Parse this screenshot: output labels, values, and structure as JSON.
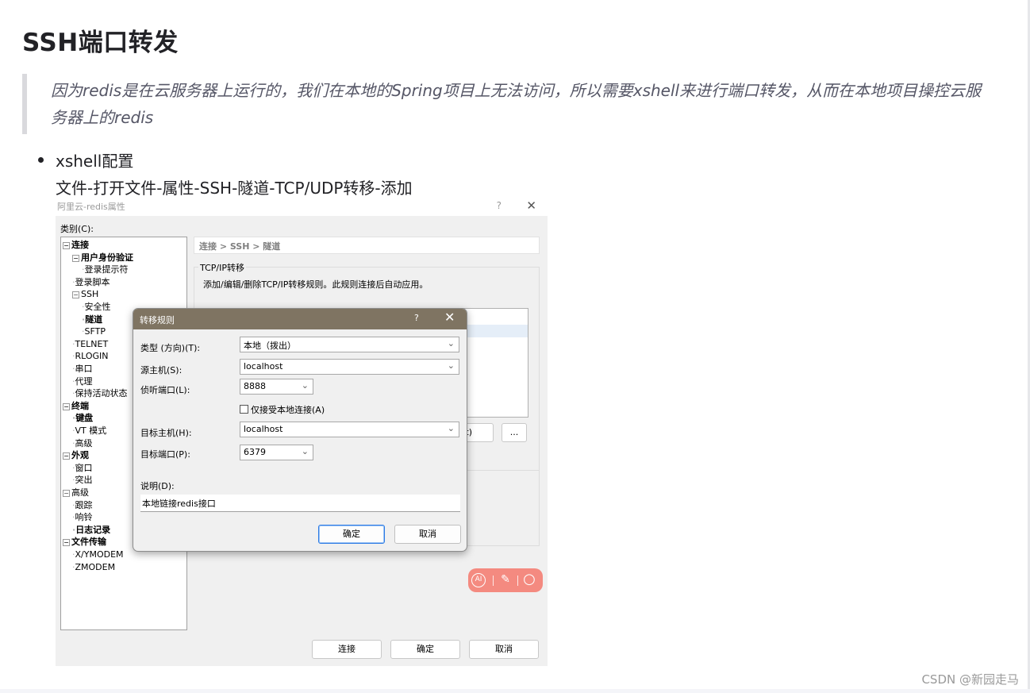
{
  "article": {
    "title": "SSH端口转发",
    "quote": "因为redis是在云服务器上运行的，我们在本地的Spring项目上无法访问，所以需要xshell来进行端口转发，从而在本地项目操控云服务器上的redis",
    "list": [
      {
        "line1": "xshell配置",
        "line2": "文件-打开文件-属性-SSH-隧道-TCP/UDP转移-添加"
      }
    ]
  },
  "screenshot": {
    "window_title": "阿里云-redis属性",
    "help_glyph": "?",
    "close_glyph": "✕",
    "category_label": "类别(C):",
    "tree": [
      {
        "label": "连接",
        "bold": true,
        "toggle": "⊟"
      },
      {
        "label": "用户身份验证",
        "bold": true,
        "toggle": "⊟"
      },
      {
        "label": "登录提示符",
        "bold": false,
        "toggle": ""
      },
      {
        "label": "登录脚本",
        "bold": false,
        "toggle": ""
      },
      {
        "label": "SSH",
        "bold": false,
        "toggle": "⊟"
      },
      {
        "label": "安全性",
        "bold": false,
        "toggle": ""
      },
      {
        "label": "隧道",
        "bold": true,
        "toggle": ""
      },
      {
        "label": "SFTP",
        "bold": false,
        "toggle": ""
      },
      {
        "label": "TELNET",
        "bold": false,
        "toggle": ""
      },
      {
        "label": "RLOGIN",
        "bold": false,
        "toggle": ""
      },
      {
        "label": "串口",
        "bold": false,
        "toggle": ""
      },
      {
        "label": "代理",
        "bold": false,
        "toggle": ""
      },
      {
        "label": "保持活动状态",
        "bold": false,
        "toggle": ""
      },
      {
        "label": "终端",
        "bold": true,
        "toggle": "⊟"
      },
      {
        "label": "键盘",
        "bold": true,
        "toggle": ""
      },
      {
        "label": "VT 模式",
        "bold": false,
        "toggle": ""
      },
      {
        "label": "高级",
        "bold": false,
        "toggle": ""
      },
      {
        "label": "外观",
        "bold": true,
        "toggle": "⊟"
      },
      {
        "label": "窗口",
        "bold": false,
        "toggle": ""
      },
      {
        "label": "突出",
        "bold": false,
        "toggle": ""
      },
      {
        "label": "高级",
        "bold": false,
        "toggle": "⊟"
      },
      {
        "label": "跟踪",
        "bold": false,
        "toggle": ""
      },
      {
        "label": "响铃",
        "bold": false,
        "toggle": ""
      },
      {
        "label": "日志记录",
        "bold": true,
        "toggle": ""
      },
      {
        "label": "文件传输",
        "bold": true,
        "toggle": "⊟"
      },
      {
        "label": "X/YMODEM",
        "bold": false,
        "toggle": ""
      },
      {
        "label": "ZMODEM",
        "bold": false,
        "toggle": ""
      }
    ],
    "breadcrumb": "连接 > SSH > 隧道",
    "group_title": "TCP/IP转移",
    "group_desc": "添加/编辑/删除TCP/IP转移规则。此规则连接后自动应用。",
    "side_button_partial": "t)",
    "more_button": "...",
    "bottom_buttons": {
      "connect": "连接",
      "ok": "确定",
      "cancel": "取消"
    },
    "ai_toolbar": {
      "ai": "AI",
      "wand": "✎",
      "search": "○"
    }
  },
  "dialog": {
    "title": "转移规则",
    "help_glyph": "?",
    "close_glyph": "✕",
    "type_label": "类型 (方向)(T):",
    "type_value": "本地（拨出）",
    "source_host_label": "源主机(S):",
    "source_host_value": "localhost",
    "listen_port_label": "侦听端口(L):",
    "listen_port_value": "8888",
    "local_only_label": "仅接受本地连接(A)",
    "local_only_checked": false,
    "target_host_label": "目标主机(H):",
    "target_host_value": "localhost",
    "target_port_label": "目标端口(P):",
    "target_port_value": "6379",
    "desc_label": "说明(D):",
    "desc_value": "本地链接redis接口",
    "ok_button": "确定",
    "cancel_button": "取消"
  },
  "watermark": "CSDN @新园走马"
}
